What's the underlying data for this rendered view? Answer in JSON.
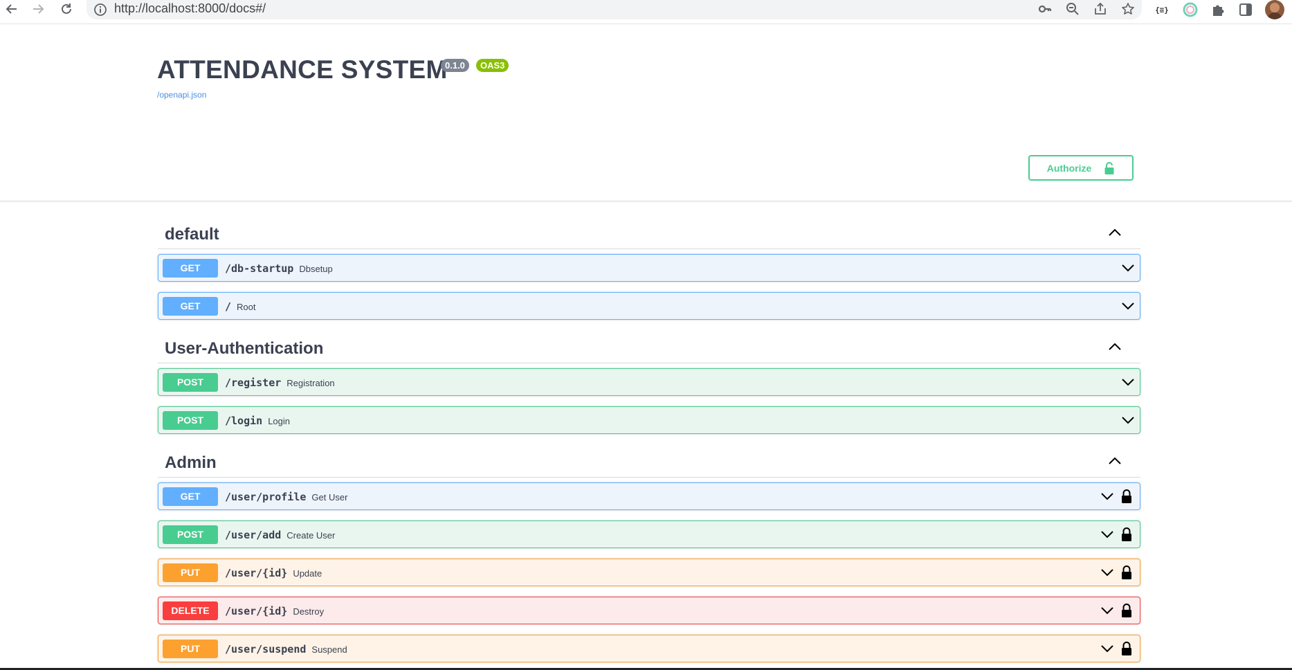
{
  "browser": {
    "url": "http://localhost:8000/docs#/",
    "extension_badge": "{≡}"
  },
  "api": {
    "title": "ATTENDANCE SYSTEM",
    "version": "0.1.0",
    "oas": "OAS3",
    "spec_link": "/openapi.json"
  },
  "authorize": {
    "label": "Authorize"
  },
  "colors": {
    "get": "#61affe",
    "post": "#49cc90",
    "put": "#fca130",
    "delete": "#f93e3e"
  },
  "tags": [
    {
      "name": "default",
      "operations": [
        {
          "method": "GET",
          "path": "/db-startup",
          "summary": "Dbsetup",
          "locked": false
        },
        {
          "method": "GET",
          "path": "/",
          "summary": "Root",
          "locked": false
        }
      ]
    },
    {
      "name": "User-Authentication",
      "operations": [
        {
          "method": "POST",
          "path": "/register",
          "summary": "Registration",
          "locked": false
        },
        {
          "method": "POST",
          "path": "/login",
          "summary": "Login",
          "locked": false
        }
      ]
    },
    {
      "name": "Admin",
      "operations": [
        {
          "method": "GET",
          "path": "/user/profile",
          "summary": "Get User",
          "locked": true
        },
        {
          "method": "POST",
          "path": "/user/add",
          "summary": "Create User",
          "locked": true
        },
        {
          "method": "PUT",
          "path": "/user/{id}",
          "summary": "Update",
          "locked": true
        },
        {
          "method": "DELETE",
          "path": "/user/{id}",
          "summary": "Destroy",
          "locked": true
        },
        {
          "method": "PUT",
          "path": "/user/suspend",
          "summary": "Suspend",
          "locked": true
        }
      ]
    }
  ]
}
